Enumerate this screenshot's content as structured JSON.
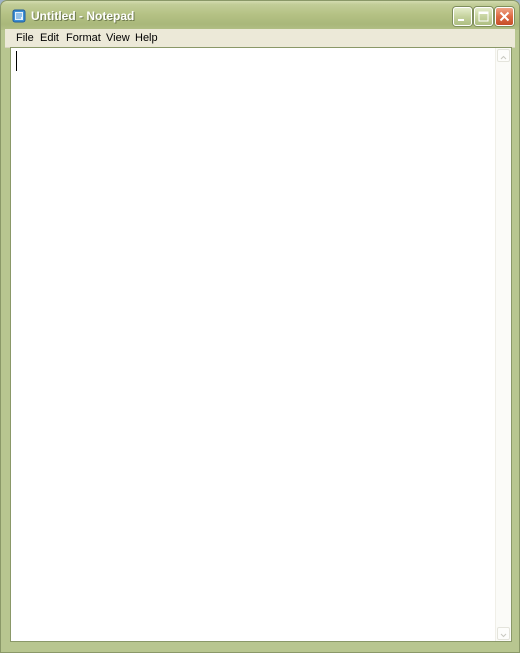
{
  "window": {
    "title": "Untitled - Notepad",
    "icon": "notepad-icon"
  },
  "controls": {
    "minimize_icon": "minimize-icon",
    "maximize_icon": "maximize-icon",
    "close_icon": "close-icon"
  },
  "menu": {
    "items": [
      {
        "label": "File"
      },
      {
        "label": "Edit"
      },
      {
        "label": "Format"
      },
      {
        "label": "View"
      },
      {
        "label": "Help"
      }
    ]
  },
  "editor": {
    "content": ""
  },
  "colors": {
    "title_bar": "#b5c285",
    "menu_bar": "#ece9d8",
    "close_button": "#dd6a44",
    "editor_background": "#ffffff"
  }
}
